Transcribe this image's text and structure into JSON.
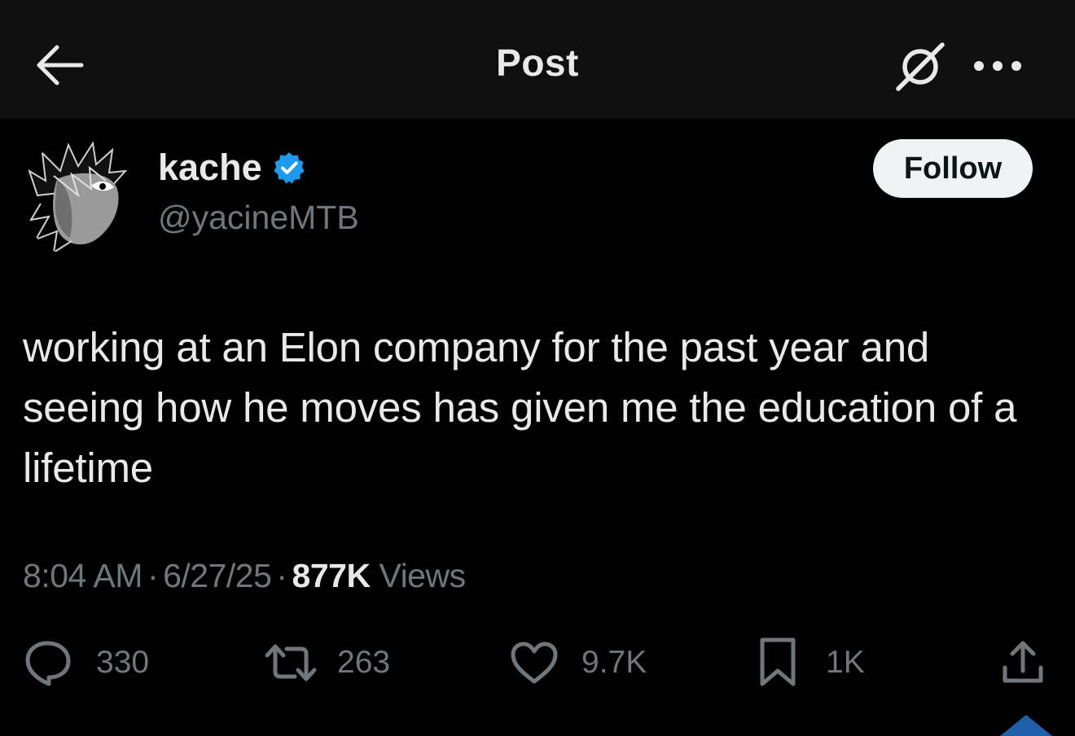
{
  "header": {
    "title": "Post",
    "back_icon": "arrow-left-icon",
    "grok_icon": "grok-icon",
    "more_icon": "more-dots-icon"
  },
  "author": {
    "display_name": "kache",
    "handle": "@yacineMTB",
    "verified": true,
    "verified_color": "#1d9bf0",
    "avatar": "anime-character-avatar"
  },
  "follow_label": "Follow",
  "tweet": {
    "text": "working at an Elon company for the past year and seeing how he moves has given me the education of a lifetime"
  },
  "meta": {
    "time": "8:04 AM",
    "date": "6/27/25",
    "views_count": "877K",
    "views_label": "Views",
    "separator": "·"
  },
  "actions": {
    "replies": "330",
    "reposts": "263",
    "likes": "9.7K",
    "bookmarks": "1K"
  },
  "colors": {
    "background": "#000000",
    "header_background": "#0f0f10",
    "text_primary": "#e7e9ea",
    "text_secondary": "#71767b",
    "follow_button_bg": "#eff3f4"
  }
}
